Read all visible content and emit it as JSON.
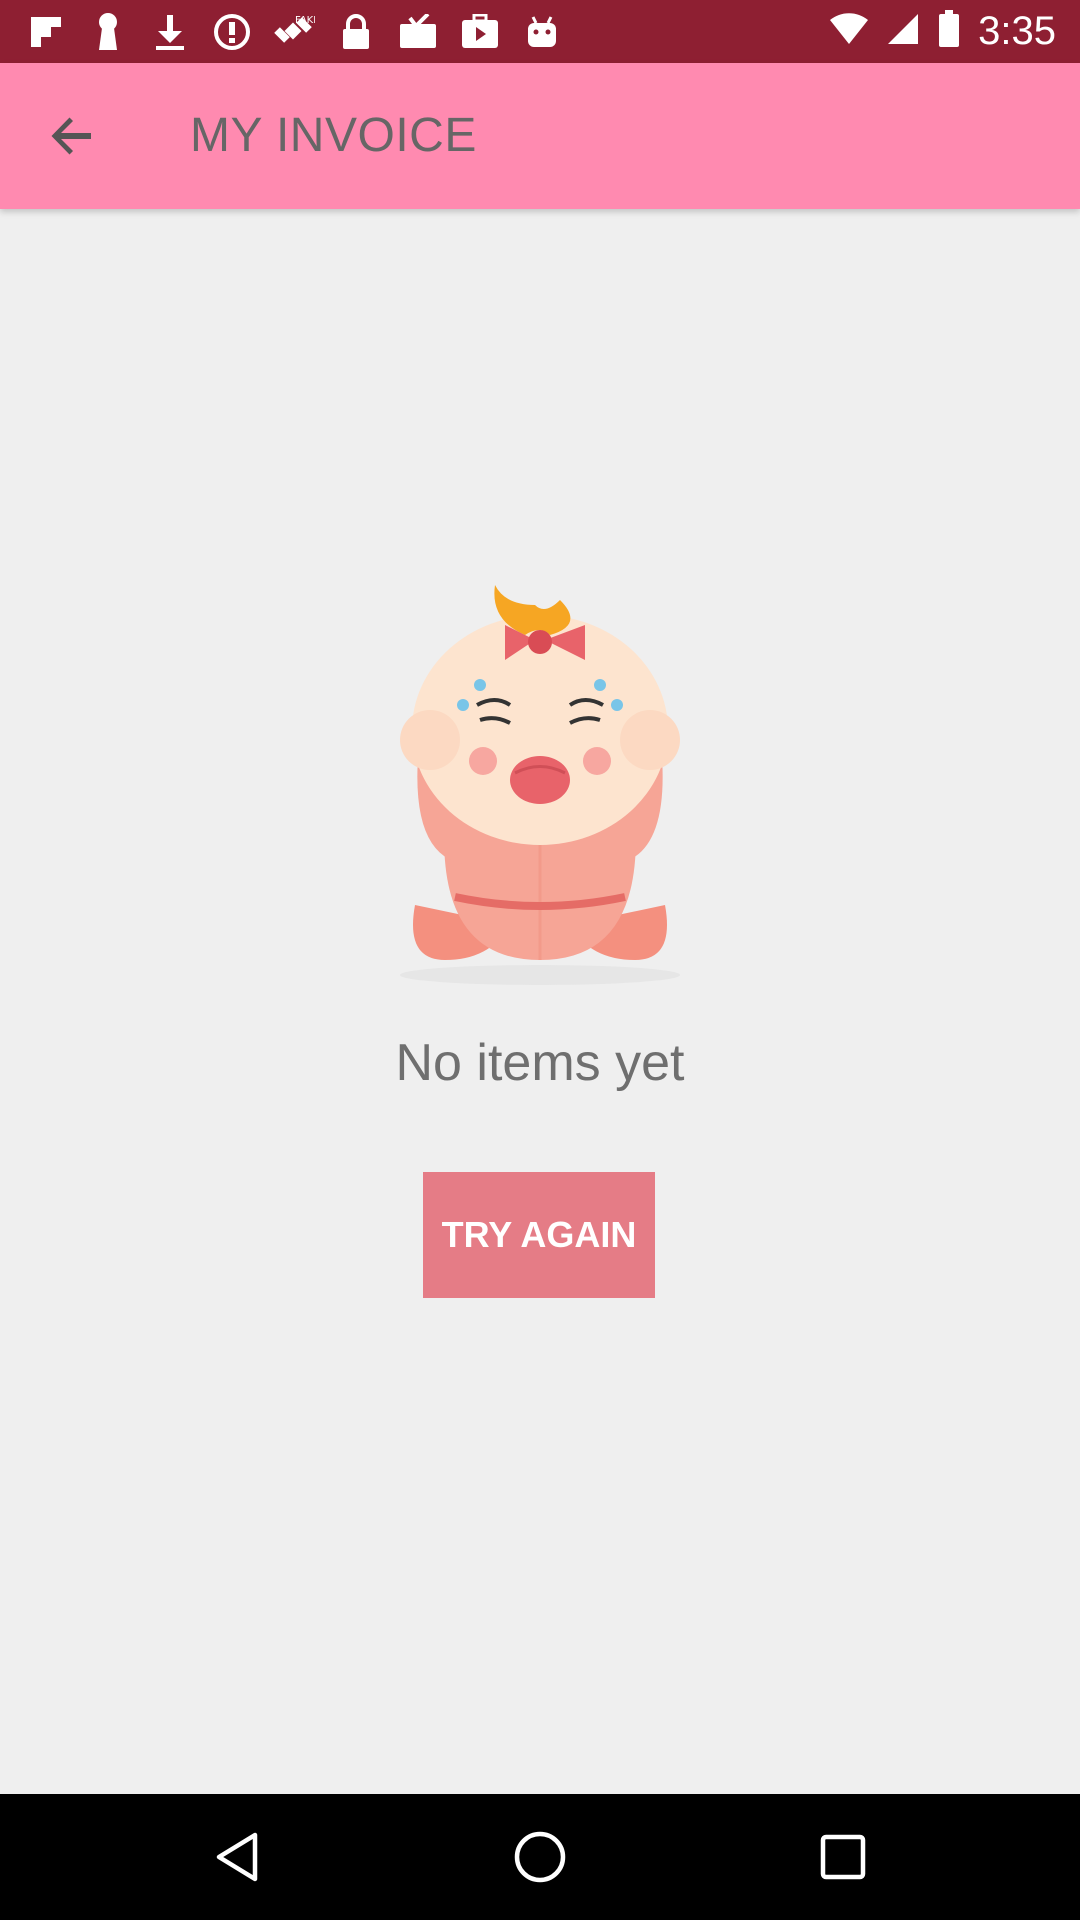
{
  "status_bar": {
    "time": "3:35",
    "icons": [
      "flipboard-icon",
      "keyhole-icon",
      "download-icon",
      "alert-icon",
      "satellite-icon",
      "lock-icon",
      "mail-check-icon",
      "play-store-icon",
      "android-icon",
      "wifi-icon",
      "signal-icon",
      "battery-icon"
    ]
  },
  "app_bar": {
    "title": "MY INVOICE",
    "back_icon": "arrow-back-icon"
  },
  "empty_state": {
    "illustration": "crying-baby-illustration",
    "message": "No items yet",
    "button_label": "TRY AGAIN"
  },
  "colors": {
    "status_bar": "#8e1f32",
    "app_bar": "#ff8ab0",
    "button": "#e57c86",
    "background": "#efefef"
  },
  "nav_bar": {
    "icons": [
      "back-triangle-icon",
      "home-circle-icon",
      "recents-square-icon"
    ]
  }
}
